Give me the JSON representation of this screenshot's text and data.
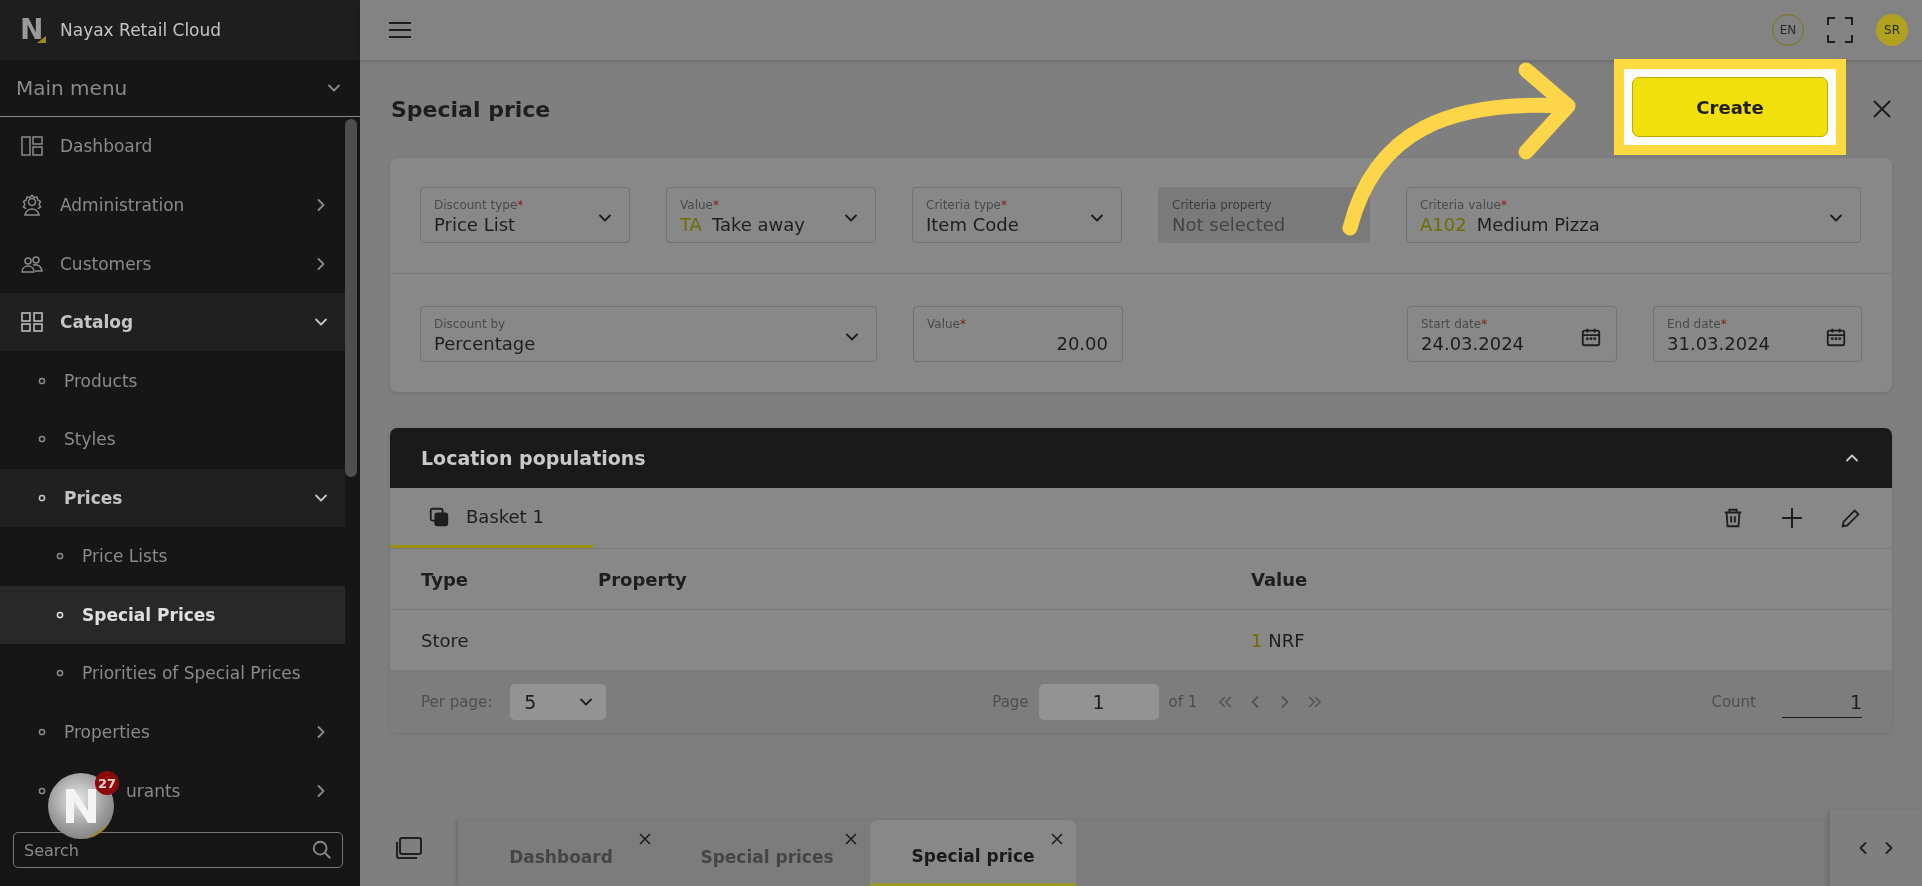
{
  "app": {
    "logo_letter": "N",
    "title": "Nayax Retail Cloud"
  },
  "sidebar": {
    "menu_title": "Main menu",
    "items": [
      {
        "label": "Dashboard",
        "kind": "link",
        "selected": false
      },
      {
        "label": "Administration",
        "kind": "group",
        "expanded": false,
        "selected": false
      },
      {
        "label": "Customers",
        "kind": "group",
        "expanded": false,
        "selected": false
      },
      {
        "label": "Catalog",
        "kind": "group",
        "expanded": true,
        "selected": false,
        "children": [
          {
            "label": "Products",
            "kind": "link",
            "selected": false
          },
          {
            "label": "Styles",
            "kind": "link",
            "selected": false
          },
          {
            "label": "Prices",
            "kind": "group",
            "expanded": true,
            "selected": false,
            "children": [
              {
                "label": "Price Lists",
                "kind": "link",
                "selected": false
              },
              {
                "label": "Special Prices",
                "kind": "link",
                "selected": true
              },
              {
                "label": "Priorities of Special Prices",
                "kind": "link",
                "selected": false
              }
            ]
          },
          {
            "label": "Properties",
            "kind": "group",
            "expanded": false,
            "selected": false
          },
          {
            "label": "urants",
            "kind": "group",
            "expanded": false,
            "selected": false
          }
        ]
      }
    ],
    "search": {
      "placeholder": "Search"
    },
    "chat_badge": {
      "count": "27"
    }
  },
  "topbar": {
    "language": "EN",
    "user_initials": "SR"
  },
  "page": {
    "title": "Special price",
    "create_button": "Create"
  },
  "form": {
    "criteria_fields": [
      {
        "kind": "select",
        "label": "Discount type",
        "required_mark": "*",
        "value": "Price List",
        "disabled": false
      },
      {
        "kind": "select",
        "label": "Value",
        "required_mark": "*",
        "code": "TA",
        "value": "Take away",
        "disabled": false
      },
      {
        "kind": "select",
        "label": "Criteria type",
        "required_mark": "*",
        "value": "Item Code",
        "disabled": false
      },
      {
        "kind": "select",
        "label": "Criteria property",
        "placeholder": "Not selected",
        "disabled": true
      },
      {
        "kind": "select",
        "label": "Criteria value",
        "required_mark": "*",
        "code": "A102",
        "value": "Medium Pizza",
        "disabled": false
      }
    ],
    "discount_fields": [
      {
        "kind": "select",
        "label": "Discount by",
        "value": "Percentage",
        "disabled": false
      },
      {
        "kind": "number",
        "label": "Value",
        "required_mark": "*",
        "value": "20.00",
        "disabled": false
      },
      {
        "kind": "date",
        "label": "Start date",
        "required_mark": "*",
        "value": "24.03.2024",
        "disabled": false
      },
      {
        "kind": "date",
        "label": "End date",
        "required_mark": "*",
        "value": "31.03.2024",
        "disabled": false
      }
    ]
  },
  "locations": {
    "title": "Location populations",
    "expanded": true,
    "baskets": [
      {
        "label": "Basket 1",
        "selected": true
      }
    ],
    "columns": [
      "Type",
      "Property",
      "Value"
    ],
    "rows": [
      {
        "type": "Store",
        "value_code": "1",
        "value": "NRF"
      }
    ],
    "pagination": {
      "per_page_label": "Per page:",
      "per_page": "5",
      "page_label": "Page",
      "page": "1",
      "page_total": "of 1",
      "count_label": "Count",
      "count": "1"
    }
  },
  "tabs": [
    {
      "label": "Dashboard",
      "selected": false
    },
    {
      "label": "Special prices",
      "selected": false
    },
    {
      "label": "Special price",
      "selected": true
    }
  ]
}
